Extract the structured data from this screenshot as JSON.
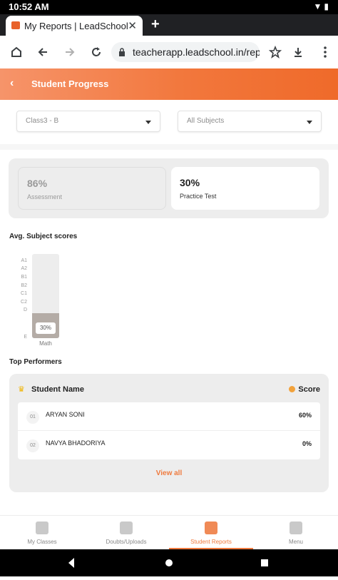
{
  "status_bar": {
    "time": "10:52 AM"
  },
  "browser": {
    "tab_title": "My Reports | LeadSchool",
    "url": "teacherapp.leadschool.in/rep"
  },
  "header": {
    "title": "Student Progress",
    "back_glyph": "‹"
  },
  "filters": {
    "class_value": "Class3 - B",
    "subject_value": "All Subjects"
  },
  "stats": {
    "assessment": {
      "value": "86%",
      "label": "Assessment"
    },
    "practice": {
      "value": "30%",
      "label": "Practice Test"
    }
  },
  "avg_scores": {
    "title": "Avg. Subject scores",
    "chart_data": {
      "type": "bar",
      "categories": [
        "Math"
      ],
      "values": [
        30
      ],
      "value_labels": [
        "30%"
      ],
      "y_ticks": [
        "A1",
        "A2",
        "B1",
        "B2",
        "C1",
        "C2",
        "D",
        "E"
      ],
      "ylim": [
        0,
        100
      ]
    }
  },
  "top_performers": {
    "title": "Top Performers",
    "col_name": "Student Name",
    "col_score": "Score",
    "rows": [
      {
        "rank": "01",
        "name": "ARYAN SONI",
        "score": "60%"
      },
      {
        "rank": "02",
        "name": "NAVYA BHADORIYA",
        "score": "0%"
      }
    ],
    "view_all": "View all"
  },
  "bottom_nav": [
    {
      "label": "My Classes",
      "icon": "classes-icon"
    },
    {
      "label": "Doubts/Uploads",
      "icon": "uploads-icon"
    },
    {
      "label": "Student Reports",
      "icon": "reports-icon",
      "active": true
    },
    {
      "label": "Menu",
      "icon": "menu-grid-icon"
    }
  ],
  "colors": {
    "accent": "#ef7a3e",
    "bar_fill": "#b4aca6"
  }
}
